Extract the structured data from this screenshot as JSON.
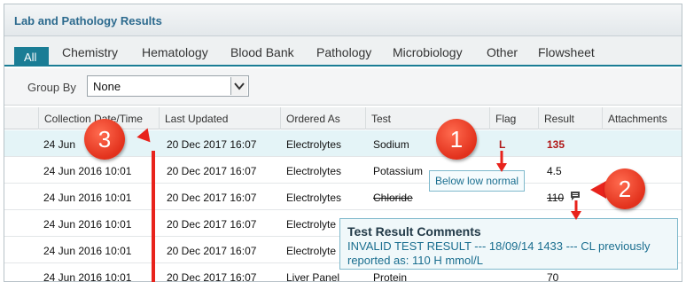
{
  "panel": {
    "title": "Lab and Pathology Results"
  },
  "tabs": [
    "All",
    "Chemistry",
    "Hematology",
    "Blood Bank",
    "Pathology",
    "Microbiology",
    "Other",
    "Flowsheet"
  ],
  "group_by": {
    "label": "Group By",
    "value": "None"
  },
  "columns": [
    "Collection Date/Time",
    "Last Updated",
    "Ordered As",
    "Test",
    "Flag",
    "Result",
    "Attachments"
  ],
  "rows": [
    {
      "collection": "24 Jun",
      "updated": "20 Dec 2017 16:07",
      "ordered": "Electrolytes",
      "test": "Sodium",
      "flag": "L",
      "result": "135"
    },
    {
      "collection": "24 Jun 2016 10:01",
      "updated": "20 Dec 2017 16:07",
      "ordered": "Electrolytes",
      "test": "Potassium",
      "flag": "",
      "result": "4.5"
    },
    {
      "collection": "24 Jun 2016 10:01",
      "updated": "20 Dec 2017 16:07",
      "ordered": "Electrolytes",
      "test": "Chloride",
      "flag": "",
      "result": "110"
    },
    {
      "collection": "24 Jun 2016 10:01",
      "updated": "20 Dec 2017 16:07",
      "ordered": "Electrolyte",
      "test": "",
      "flag": "",
      "result": ""
    },
    {
      "collection": "24 Jun 2016 10:01",
      "updated": "20 Dec 2017 16:07",
      "ordered": "Electrolyte",
      "test": "",
      "flag": "",
      "result": ""
    },
    {
      "collection": "24 Jun 2016 10:01",
      "updated": "20 Dec 2017 16:07",
      "ordered": "Liver Panel",
      "test": "Protein",
      "flag": "",
      "result": "70"
    }
  ],
  "tooltip_flag": "Below low normal",
  "tooltip_comments": {
    "title": "Test Result Comments",
    "body": "INVALID TEST RESULT --- 18/09/14 1433 --- CL previously reported as: 110 H mmol/L"
  },
  "callouts": [
    "1",
    "2",
    "3"
  ],
  "colors": {
    "accent": "#1a7d95",
    "flag_red": "#b01818",
    "callout_red": "#e2311c",
    "arrow_red": "#e8231c"
  },
  "icons": {
    "comment": "comment-icon",
    "dropdown": "chevron-down-icon"
  }
}
